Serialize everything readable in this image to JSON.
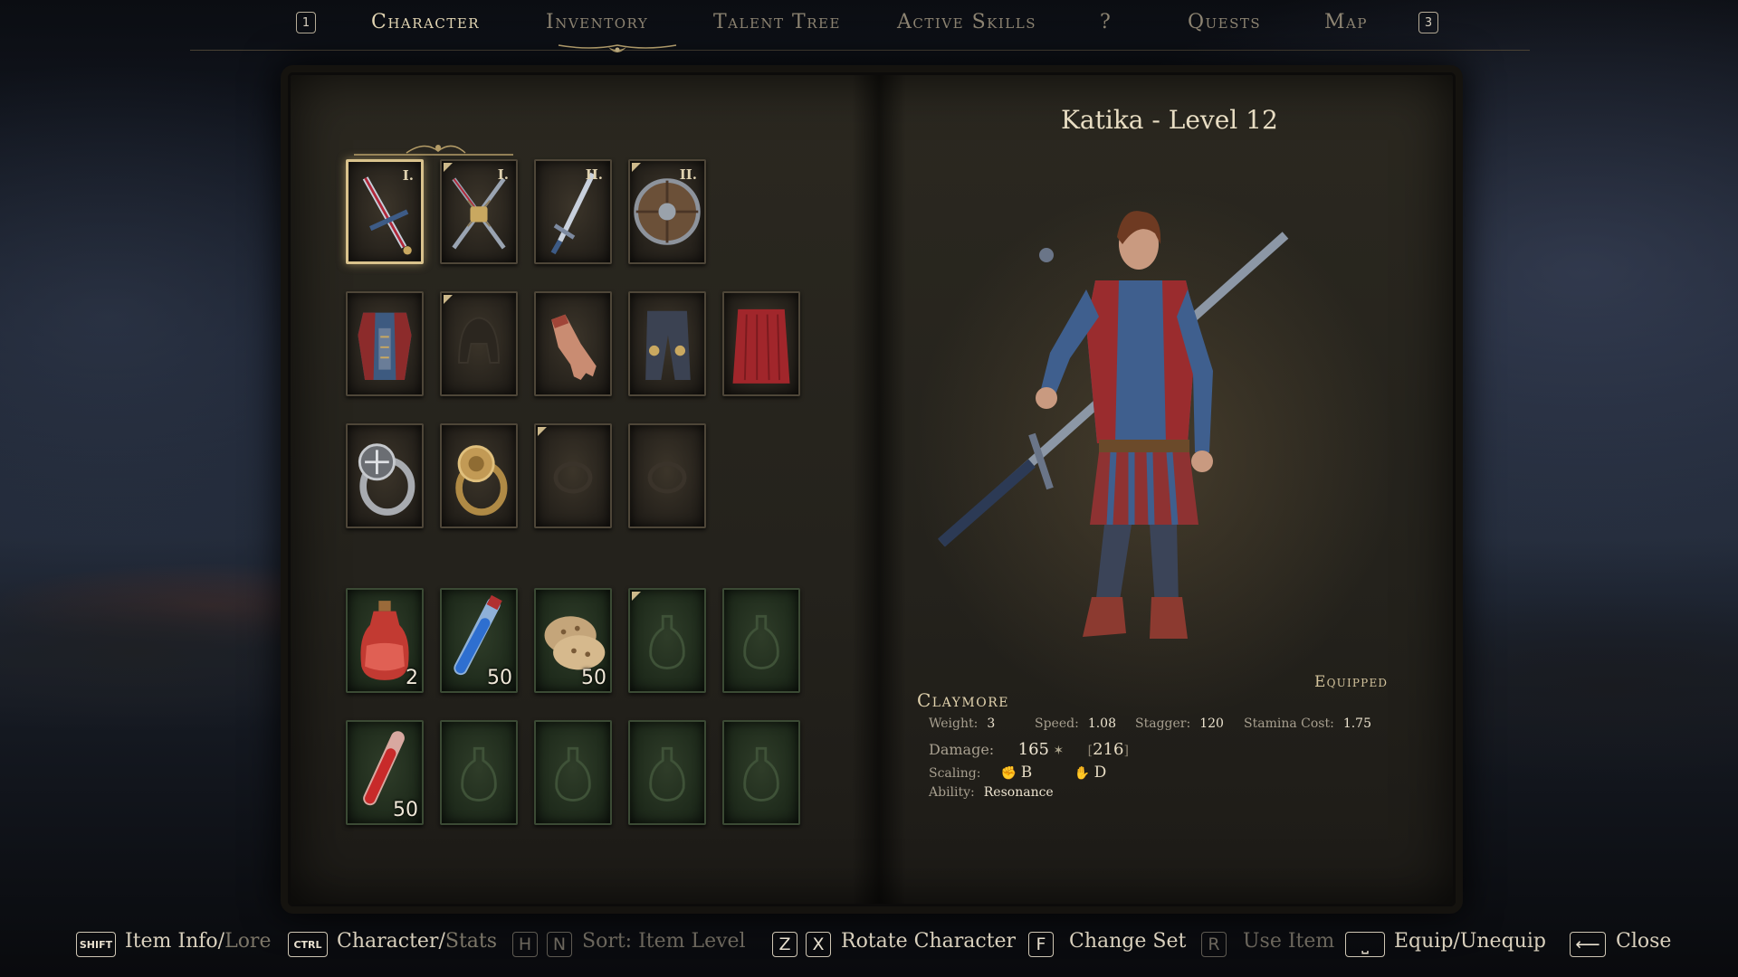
{
  "nav": {
    "left_key": "1",
    "right_key": "3",
    "tabs": [
      {
        "label": "Character",
        "active": true
      },
      {
        "label": "Inventory",
        "active": false
      },
      {
        "label": "Talent Tree",
        "active": false
      },
      {
        "label": "Active Skills",
        "active": false
      },
      {
        "label": "?",
        "active": false
      },
      {
        "label": "Quests",
        "active": false
      },
      {
        "label": "Map",
        "active": false
      }
    ]
  },
  "character": {
    "title": "Katika - Level 12"
  },
  "equipment": {
    "weapons": [
      {
        "icon": "claymore-icon",
        "numeral": "I.",
        "selected": true
      },
      {
        "icon": "crossed-swords-locked-icon",
        "numeral": "I."
      },
      {
        "icon": "sword-icon",
        "numeral": "II."
      },
      {
        "icon": "round-shield-icon",
        "numeral": "II."
      }
    ],
    "armor": [
      {
        "icon": "brigandine-icon"
      },
      {
        "icon": "helmet-placeholder-icon"
      },
      {
        "icon": "gauntlet-icon"
      },
      {
        "icon": "leggings-icon"
      },
      {
        "icon": "red-cloak-icon"
      }
    ],
    "rings": [
      {
        "icon": "silver-ring-icon"
      },
      {
        "icon": "lion-ring-icon"
      },
      {
        "icon": "ring-placeholder-icon"
      },
      {
        "icon": "ring-placeholder-icon"
      }
    ],
    "quick_row1": [
      {
        "icon": "health-potion-icon",
        "qty": "2"
      },
      {
        "icon": "blue-vial-icon",
        "qty": "50"
      },
      {
        "icon": "bread-icon",
        "qty": "50"
      },
      {
        "icon": "flask-placeholder-icon",
        "qty": ""
      },
      {
        "icon": "flask-placeholder-icon",
        "qty": ""
      }
    ],
    "quick_row2": [
      {
        "icon": "red-vial-icon",
        "qty": "50"
      },
      {
        "icon": "flask-placeholder-icon",
        "qty": ""
      },
      {
        "icon": "flask-placeholder-icon",
        "qty": ""
      },
      {
        "icon": "flask-placeholder-icon",
        "qty": ""
      },
      {
        "icon": "flask-placeholder-icon",
        "qty": ""
      }
    ]
  },
  "item": {
    "name": "Claymore",
    "status": "Equipped",
    "weight_label": "Weight:",
    "weight": "3",
    "speed_label": "Speed:",
    "speed": "1.08",
    "stagger_label": "Stagger:",
    "stagger": "120",
    "stamina_label": "Stamina Cost:",
    "stamina": "1.75",
    "damage_label": "Damage:",
    "damage": "165",
    "damage_alt": "216",
    "scaling_label": "Scaling:",
    "scaling_str": "B",
    "scaling_dex": "D",
    "ability_label": "Ability:",
    "ability": "Resonance"
  },
  "hints": {
    "shift_key": "SHIFT",
    "item_info": "Item Info/",
    "lore": "Lore",
    "ctrl_key": "CTRL",
    "character": "Character/",
    "stats": "Stats",
    "h_key": "H",
    "n_key": "N",
    "sort": "Sort: Item Level",
    "z_key": "Z",
    "x_key": "X",
    "rotate": "Rotate Character",
    "f_key": "F",
    "change_set": "Change Set",
    "r_key": "R",
    "use_item": "Use Item",
    "equip": "Equip/Unequip",
    "close": "Close"
  },
  "colors": {
    "gold_accent": "#d9c28c",
    "text_primary": "#e8ddc3",
    "text_dim": "#8d8472",
    "quick_slot_green": "#2f3d29"
  }
}
